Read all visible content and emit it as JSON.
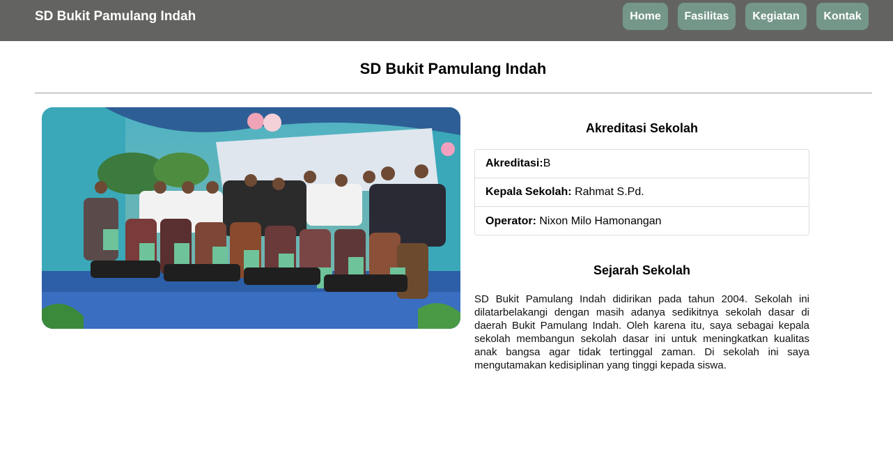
{
  "navbar": {
    "brand": "SD Bukit Pamulang Indah",
    "links": [
      "Home",
      "Fasilitas",
      "Kegiatan",
      "Kontak"
    ]
  },
  "main": {
    "title": "SD Bukit Pamulang Indah",
    "photo": {
      "icon": "school-group-photo"
    },
    "akreditasi": {
      "title": "Akreditasi Sekolah",
      "rows": [
        {
          "label": "Akreditasi:",
          "value": "B"
        },
        {
          "label": "Kepala Sekolah:",
          "value": "Rahmat S.Pd."
        },
        {
          "label": "Operator:",
          "value": "Nixon Milo Hamonangan"
        }
      ]
    },
    "sejarah": {
      "title": "Sejarah Sekolah",
      "text": "SD Bukit Pamulang Indah didirikan pada tahun 2004. Sekolah ini dilatarbelakangi dengan masih adanya sedikitnya sekolah dasar di daerah Bukit Pamulang Indah. Oleh karena itu, saya sebagai kepala sekolah membangun sekolah dasar ini untuk meningkatkan kualitas anak bangsa agar tidak tertinggal zaman. Di sekolah ini saya mengutamakan kedisiplinan yang tinggi kepada siswa."
    }
  },
  "colors": {
    "navbar_bg": "#636462",
    "nav_button_bg": "#74978a",
    "stage_blue": "#2d5fa8"
  }
}
